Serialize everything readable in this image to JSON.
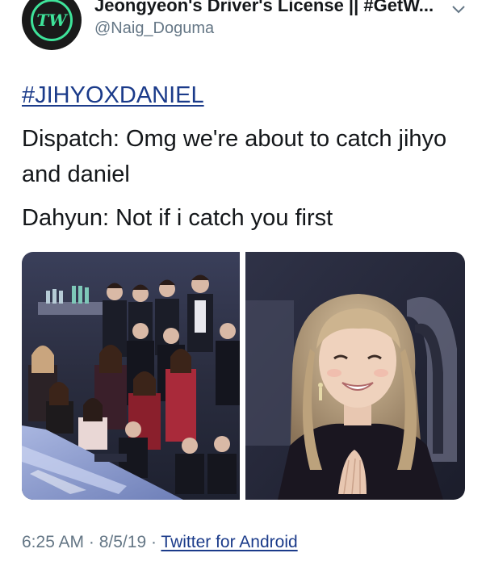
{
  "tweet": {
    "author": {
      "display_name": "Jeongyeon's Driver's License || #GetW...",
      "handle": "@Naig_Doguma",
      "avatar_icon": "twice-logo-icon",
      "avatar_text": "TW"
    },
    "menu_icon": "chevron-down-icon",
    "hashtag": "#JIHYOXDANIEL",
    "lines": [
      "Dispatch: Omg we're about to catch jihyo and daniel",
      "Dahyun: Not if i catch you first"
    ],
    "media": [
      {
        "name": "media-photo-crowd"
      },
      {
        "name": "media-photo-closeup"
      }
    ],
    "meta": {
      "time": "6:25 AM",
      "separator": " · ",
      "date": "8/5/19",
      "source": "Twitter for Android"
    }
  },
  "colors": {
    "link": "#1b3b8a",
    "secondary_text": "#657786",
    "avatar_accent": "#3ee39a"
  }
}
